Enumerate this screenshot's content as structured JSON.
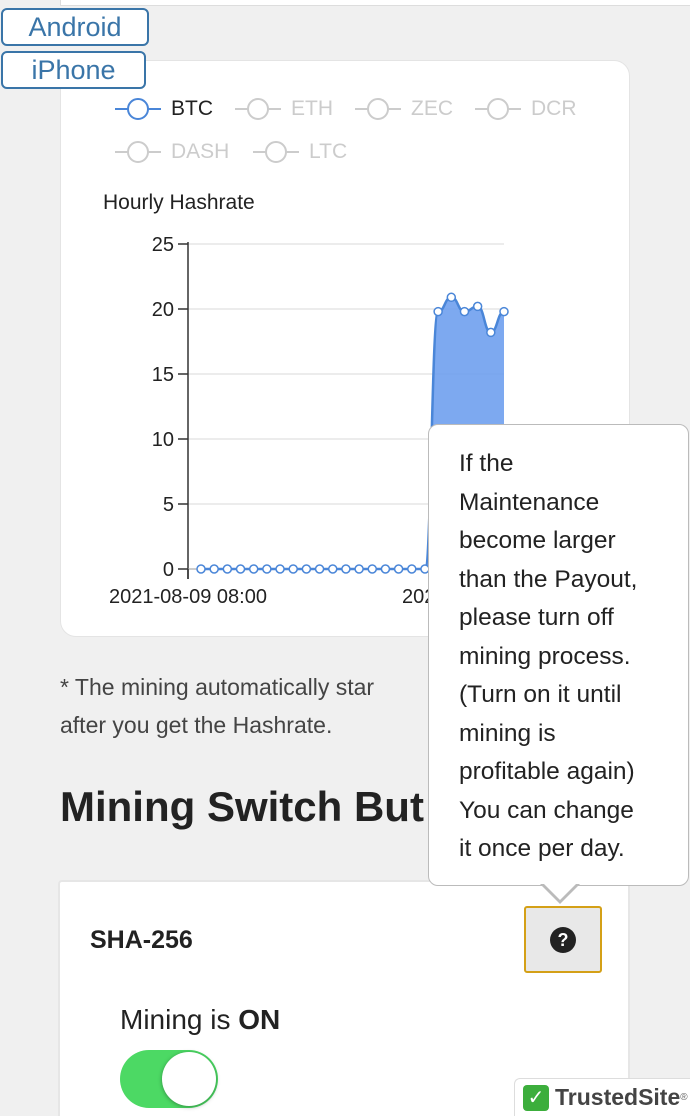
{
  "os_buttons": {
    "android": "Android",
    "iphone": "iPhone"
  },
  "legend": [
    {
      "label": "BTC",
      "active": true
    },
    {
      "label": "ETH",
      "active": false
    },
    {
      "label": "ZEC",
      "active": false
    },
    {
      "label": "DCR",
      "active": false
    },
    {
      "label": "DASH",
      "active": false
    },
    {
      "label": "LTC",
      "active": false
    }
  ],
  "chart_title": "Hourly Hashrate",
  "chart_data": {
    "type": "area",
    "title": "Hourly Hashrate",
    "series": [
      {
        "name": "BTC",
        "color": "#6fa0ee",
        "values": [
          0,
          0,
          0,
          0,
          0,
          0,
          0,
          0,
          0,
          0,
          0,
          0,
          0,
          0,
          0,
          0,
          0,
          0,
          19.8,
          20.9,
          19.8,
          20.2,
          18.2,
          19.8
        ]
      }
    ],
    "ylim": [
      0,
      25
    ],
    "yticks": [
      "0",
      "5",
      "10",
      "15",
      "20",
      "25"
    ],
    "xtick_labels": [
      "2021-08-09 08:00",
      "202"
    ],
    "grid": true,
    "legend_position": "top"
  },
  "note": {
    "line1": "* The mining automatically star",
    "line2": "after you get the Hashrate."
  },
  "section_heading": "Mining Switch But",
  "algo_card": {
    "name": "SHA-256",
    "help_glyph": "?",
    "status_prefix": "Mining is ",
    "status_value": "ON",
    "toggle_on": true
  },
  "tooltip": {
    "lines": [
      "If the",
      "Maintenance",
      "become larger",
      "than the Payout,",
      "please turn off",
      "mining process.",
      "(Turn on it until",
      "mining is",
      "profitable again)",
      "You can change",
      "it once per day."
    ]
  },
  "trusted_site": {
    "label": "TrustedSite",
    "reg": "®",
    "check": "✓"
  }
}
